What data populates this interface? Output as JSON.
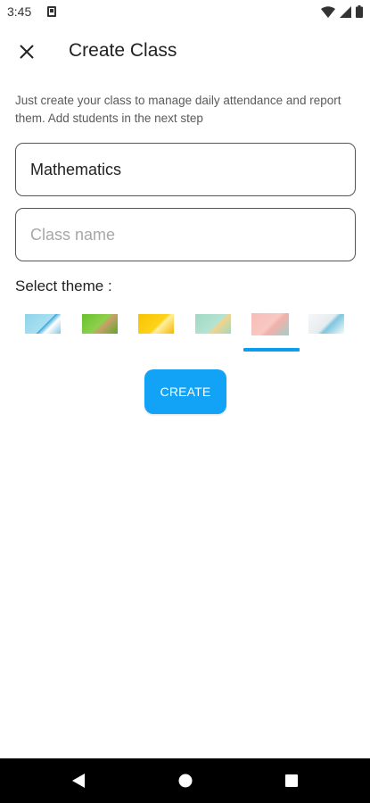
{
  "status_bar": {
    "time": "3:45",
    "icons": [
      "notification-icon",
      "wifi-icon",
      "signal-icon",
      "battery-icon"
    ]
  },
  "app_bar": {
    "title": "Create Class",
    "close_icon": "close-icon"
  },
  "description": "Just create your class to manage daily attendance and report them. Add students in the next step",
  "form": {
    "subject": {
      "value": "Mathematics",
      "placeholder": ""
    },
    "class_name": {
      "value": "",
      "placeholder": "Class name"
    }
  },
  "themes": {
    "label": "Select theme :",
    "count": 6,
    "selected_index": 4,
    "accent_color": "#0b9ef0"
  },
  "create_button": {
    "label": "CREATE",
    "color": "#12a3f6"
  },
  "nav_bar": {
    "icons": [
      "back-icon",
      "home-icon",
      "recents-icon"
    ]
  }
}
